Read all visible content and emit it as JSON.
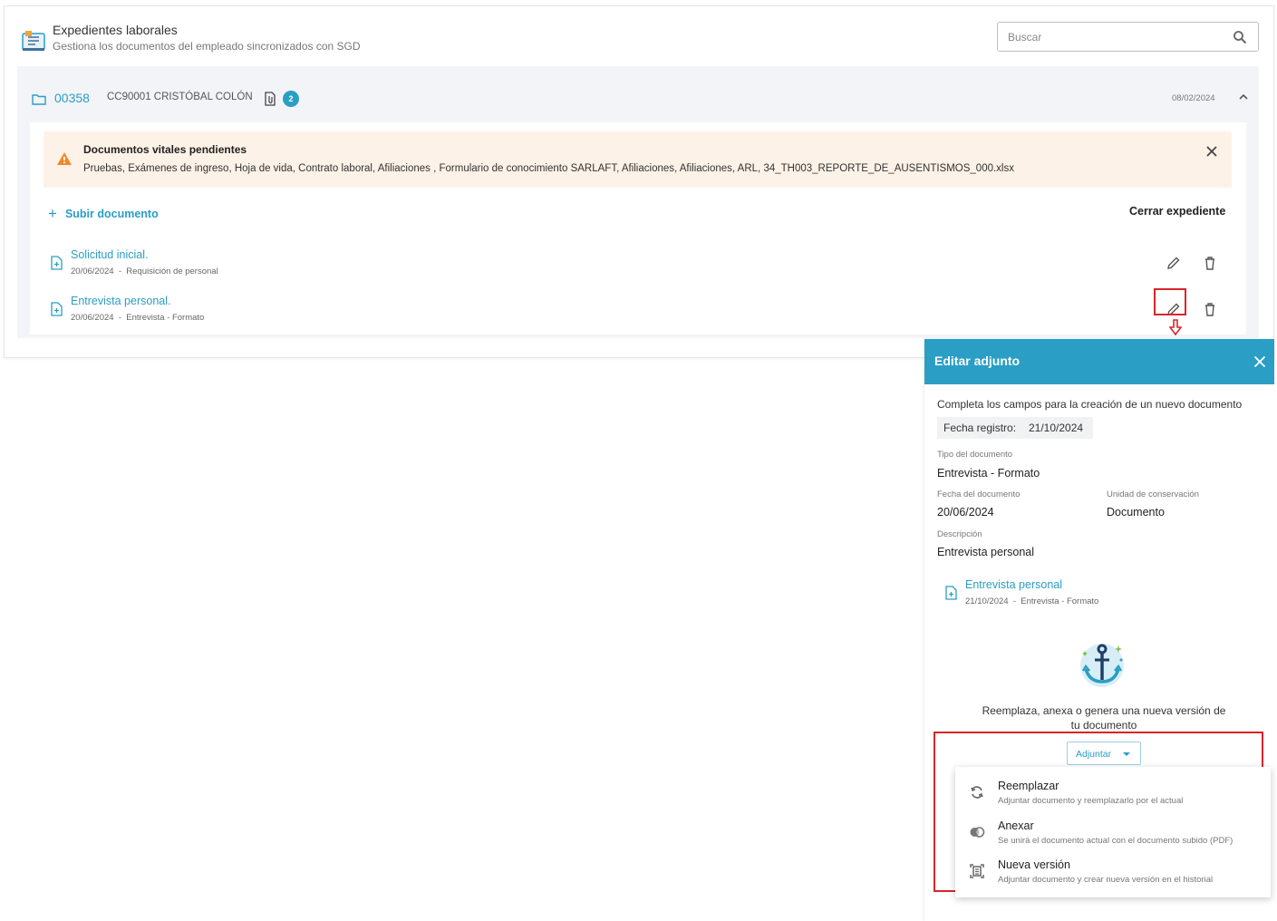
{
  "header": {
    "title": "Expedientes laborales",
    "subtitle": "Gestiona los documentos del empleado sincronizados con SGD",
    "search_placeholder": "Buscar"
  },
  "record": {
    "id": "00358",
    "name": "CC90001 CRISTÓBAL COLÓN",
    "doc_count": "2",
    "date": "08/02/2024",
    "alert": {
      "title": "Documentos vitales pendientes",
      "text": "Pruebas, Exámenes de ingreso, Hoja de vida, Contrato laboral, Afiliaciones , Formulario de conocimiento SARLAFT, Afiliaciones, Afiliaciones, ARL, 34_TH003_REPORTE_DE_AUSENTISMOS_000.xlsx"
    },
    "upload_label": "Subir documento",
    "close_label": "Cerrar expediente",
    "documents": [
      {
        "title": "Solicitud inicial.",
        "date": "20/06/2024",
        "sep": "-",
        "type": "Requisición de personal"
      },
      {
        "title": "Entrevista personal.",
        "date": "20/06/2024",
        "sep": "-",
        "type": "Entrevista - Formato"
      }
    ]
  },
  "edit_panel": {
    "title": "Editar adjunto",
    "intro": "Completa los campos para la creación de un nuevo documento",
    "registration_label": "Fecha registro:",
    "registration_date": "21/10/2024",
    "doc_type_label": "Tipo del documento",
    "doc_type_value": "Entrevista - Formato",
    "doc_date_label": "Fecha del documento",
    "doc_date_value": "20/06/2024",
    "unit_label": "Unidad de conservación",
    "unit_value": "Documento",
    "description_label": "Descripción",
    "description_value": "Entrevista personal",
    "attachment": {
      "title": "Entrevista personal",
      "date": "21/10/2024",
      "sep": "-",
      "type": "Entrevista - Formato"
    },
    "replace_text": "Reemplaza, anexa o genera una nueva versión de tu documento",
    "attach_button": "Adjuntar",
    "menu": [
      {
        "icon": "sync-icon",
        "label": "Reemplazar",
        "desc": "Adjuntar documento y reemplazarlo por el actual"
      },
      {
        "icon": "merge-icon",
        "label": "Anexar",
        "desc": "Se unirá el documento actual con el documento subido (PDF)"
      },
      {
        "icon": "new-version-icon",
        "label": "Nueva versión",
        "desc": "Adjuntar documento y crear nueva versión en el historial"
      }
    ]
  },
  "colors": {
    "accent": "#2a9ec4",
    "alert_bg": "#fdf2e7",
    "warning": "#f0892b",
    "highlight": "#d8252b"
  }
}
